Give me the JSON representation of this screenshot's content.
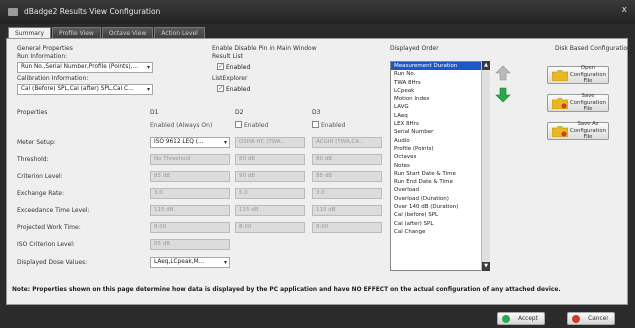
{
  "window": {
    "title": "dBadge2 Results View Configuration",
    "close_glyph": "x"
  },
  "tabs": [
    "Summary",
    "Profile View",
    "Octave View",
    "Action Level"
  ],
  "general": {
    "heading": "General Properties",
    "run_info_label": "Run Information:",
    "run_info_value": "Run No.,Serial Number,Profile (Points),...",
    "calibration_label": "Calibration Information:",
    "calibration_value": "Cal (Before) SPL,Cal (after) SPL,Cal C..."
  },
  "enable_disable": {
    "heading": "Enable Disable Pin in Main Window",
    "result_list_label": "Result List",
    "result_list_check": "Enabled",
    "list_explorer_label": "ListExplorer",
    "list_explorer_check": "Enabled"
  },
  "properties": {
    "heading": "Properties",
    "columns": [
      "D1",
      "D2",
      "D3"
    ],
    "d1_state": "Enabled (Always On)",
    "d2_state": "Enabled",
    "d3_state": "Enabled",
    "rows": [
      {
        "label": "Meter Setup:",
        "d1": "ISO 9612 LEQ (...",
        "d2": "OSHA HC (TWA...",
        "d3": "ACGIH (TWA,CA..."
      },
      {
        "label": "Threshold:",
        "d1": "No Threshold",
        "d2": "80 dB",
        "d3": "80 dB"
      },
      {
        "label": "Criterion Level:",
        "d1": "85 dB",
        "d2": "90 dB",
        "d3": "85 dB"
      },
      {
        "label": "Exchange Rate:",
        "d1": "3.0",
        "d2": "5.0",
        "d3": "3.0"
      },
      {
        "label": "Exceedance Time Level:",
        "d1": "115 dB",
        "d2": "115 dB",
        "d3": "115 dB"
      },
      {
        "label": "Projected Work Time:",
        "d1": "8:00",
        "d2": "8:00",
        "d3": "8:00"
      },
      {
        "label": "ISO Criterion Level:",
        "d1": "85 dB",
        "d2": "",
        "d3": ""
      },
      {
        "label": "Displayed Dose Values:",
        "d1": "LAeq,LCpeak,M...",
        "d2": "",
        "d3": ""
      }
    ]
  },
  "displayed_order": {
    "heading": "Displayed Order",
    "items": [
      "Measurement Duration",
      "Run No.",
      "TWA 8Hrs",
      "LCpeak",
      "Motion Index",
      "LAVG",
      "LAeq",
      "LEX 8Hrs",
      "Serial Number",
      "Audio",
      "Profile (Points)",
      "Octaves",
      "Notes",
      "Run Start Date & Time",
      "Run End Date & Time",
      "Overload",
      "Overload (Duration)",
      "Over 140 dB (Duration)",
      "Cal (before) SPL",
      "Cal (after) SPL",
      "Cal Change"
    ],
    "selected_index": 0
  },
  "disk_config": {
    "heading": "Disk Based Configuration",
    "open_label": "Open Configuration File",
    "save_label": "Save Configuration File",
    "save_as_label": "Save As Configuration File"
  },
  "note": "Note: Properties shown on this page determine how data is displayed by the PC application and have NO EFFECT on the actual configuration of any attached device.",
  "buttons": {
    "accept": "Accept",
    "cancel": "Cancel"
  },
  "colors": {
    "selection": "#1e57c8",
    "accept_icon": "#2aa84a",
    "cancel_icon": "#d23a2a",
    "move_up": "#b9b9b9",
    "move_down": "#29a84a"
  }
}
